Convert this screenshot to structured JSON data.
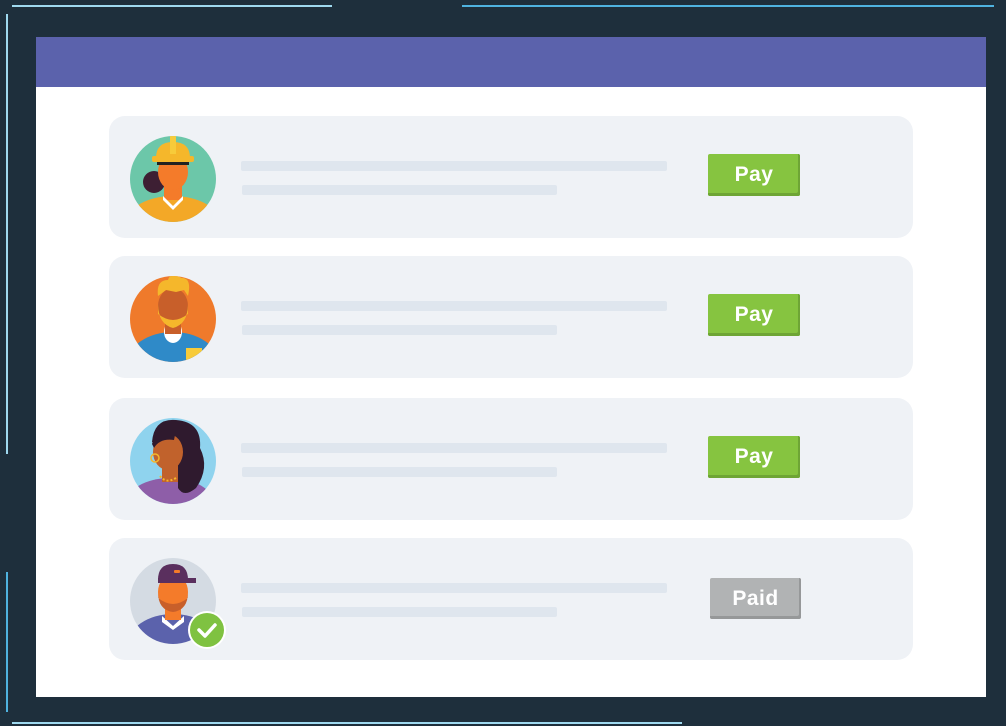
{
  "window": {
    "title": ""
  },
  "payees": [
    {
      "avatar": "construction-worker-avatar",
      "status": "pay",
      "action_label": "Pay",
      "verified": false
    },
    {
      "avatar": "bearded-man-avatar",
      "status": "pay",
      "action_label": "Pay",
      "verified": false
    },
    {
      "avatar": "woman-earring-avatar",
      "status": "pay",
      "action_label": "Pay",
      "verified": false
    },
    {
      "avatar": "man-cap-avatar",
      "status": "paid",
      "action_label": "Paid",
      "verified": true
    }
  ],
  "colors": {
    "background": "#1e2f3c",
    "titlebar": "#5b62ac",
    "row_bg": "#eff2f6",
    "pay_button": "#86c440",
    "paid_button": "#b1b3b4",
    "check_badge": "#7fc241"
  }
}
